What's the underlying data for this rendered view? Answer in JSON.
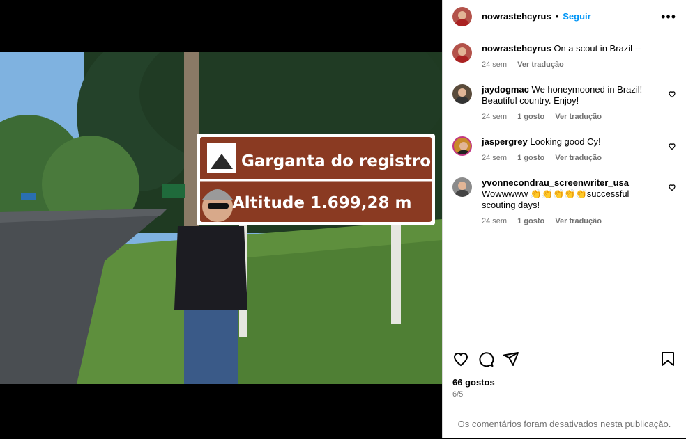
{
  "post": {
    "author": "nowrastehcyrus",
    "separator": "•",
    "follow_label": "Seguir",
    "more_label": "•••",
    "photo_sign_line1": "Garganta do registro",
    "photo_sign_line2": "Altitude  1.699,28 m"
  },
  "comments": [
    {
      "username": "nowrastehcyrus",
      "text": "On a scout in Brazil --",
      "age": "24 sem",
      "likes": "",
      "translate": "Ver tradução"
    },
    {
      "username": "jaydogmac",
      "text": "We honeymooned in Brazil! Beautiful country. Enjoy!",
      "age": "24 sem",
      "likes": "1 gosto",
      "translate": "Ver tradução"
    },
    {
      "username": "jaspergrey",
      "text": "Looking good Cy!",
      "age": "24 sem",
      "likes": "1 gosto",
      "translate": "Ver tradução"
    },
    {
      "username": "yvonnecondrau_screenwriter_usa",
      "text": "Wowwwww 👏👏👏👏👏successful scouting days!",
      "age": "24 sem",
      "likes": "1 gosto",
      "translate": "Ver tradução"
    }
  ],
  "footer": {
    "likes": "66 gostos",
    "date": "6/5",
    "comments_disabled": "Os comentários foram desativados nesta publicação."
  }
}
